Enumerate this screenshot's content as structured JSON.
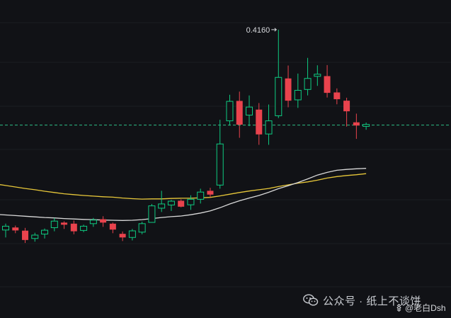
{
  "chart_data": {
    "type": "candlestick",
    "annotation": {
      "label": "0.4160",
      "value": 0.416
    },
    "current_price_line": 0.371,
    "ylim": [
      0.28,
      0.43
    ],
    "grid": "horizontal",
    "colors": {
      "up": "#0ecb81",
      "down": "#e9434d",
      "ma_fast": "#d9d9d9",
      "ma_slow": "#e7c739",
      "price_line": "#2ebd85",
      "background": "#111216",
      "grid": "#1c1e23"
    },
    "candles": [
      {
        "o": 0.3215,
        "h": 0.3245,
        "l": 0.318,
        "c": 0.3233
      },
      {
        "o": 0.3227,
        "h": 0.3236,
        "l": 0.32,
        "c": 0.3213
      },
      {
        "o": 0.3212,
        "h": 0.3225,
        "l": 0.3154,
        "c": 0.3168
      },
      {
        "o": 0.3175,
        "h": 0.3202,
        "l": 0.316,
        "c": 0.3191
      },
      {
        "o": 0.3196,
        "h": 0.3222,
        "l": 0.3175,
        "c": 0.3214
      },
      {
        "o": 0.3226,
        "h": 0.3272,
        "l": 0.3209,
        "c": 0.3257
      },
      {
        "o": 0.325,
        "h": 0.3256,
        "l": 0.322,
        "c": 0.324
      },
      {
        "o": 0.3245,
        "h": 0.326,
        "l": 0.3195,
        "c": 0.3209
      },
      {
        "o": 0.3213,
        "h": 0.324,
        "l": 0.3205,
        "c": 0.3233
      },
      {
        "o": 0.3245,
        "h": 0.3272,
        "l": 0.323,
        "c": 0.3262
      },
      {
        "o": 0.3266,
        "h": 0.328,
        "l": 0.323,
        "c": 0.325
      },
      {
        "o": 0.3245,
        "h": 0.325,
        "l": 0.32,
        "c": 0.3217
      },
      {
        "o": 0.3197,
        "h": 0.3208,
        "l": 0.3163,
        "c": 0.318
      },
      {
        "o": 0.318,
        "h": 0.322,
        "l": 0.3166,
        "c": 0.3211
      },
      {
        "o": 0.3205,
        "h": 0.3254,
        "l": 0.3195,
        "c": 0.3245
      },
      {
        "o": 0.3251,
        "h": 0.3338,
        "l": 0.325,
        "c": 0.3329
      },
      {
        "o": 0.3318,
        "h": 0.34,
        "l": 0.33,
        "c": 0.3338
      },
      {
        "o": 0.3333,
        "h": 0.3357,
        "l": 0.3305,
        "c": 0.3351
      },
      {
        "o": 0.3353,
        "h": 0.336,
        "l": 0.3322,
        "c": 0.3325
      },
      {
        "o": 0.3334,
        "h": 0.3379,
        "l": 0.331,
        "c": 0.336
      },
      {
        "o": 0.336,
        "h": 0.341,
        "l": 0.334,
        "c": 0.3394
      },
      {
        "o": 0.34,
        "h": 0.3414,
        "l": 0.337,
        "c": 0.3382
      },
      {
        "o": 0.3427,
        "h": 0.3735,
        "l": 0.341,
        "c": 0.3621
      },
      {
        "o": 0.373,
        "h": 0.3853,
        "l": 0.3708,
        "c": 0.3822
      },
      {
        "o": 0.3824,
        "h": 0.3868,
        "l": 0.365,
        "c": 0.3712
      },
      {
        "o": 0.3757,
        "h": 0.385,
        "l": 0.3705,
        "c": 0.3795
      },
      {
        "o": 0.3783,
        "h": 0.3814,
        "l": 0.3617,
        "c": 0.3666
      },
      {
        "o": 0.3668,
        "h": 0.3807,
        "l": 0.3617,
        "c": 0.373
      },
      {
        "o": 0.3754,
        "h": 0.416,
        "l": 0.3743,
        "c": 0.3935
      },
      {
        "o": 0.393,
        "h": 0.3991,
        "l": 0.3794,
        "c": 0.3825
      },
      {
        "o": 0.3829,
        "h": 0.3953,
        "l": 0.3791,
        "c": 0.3874
      },
      {
        "o": 0.3878,
        "h": 0.4027,
        "l": 0.385,
        "c": 0.393
      },
      {
        "o": 0.394,
        "h": 0.3992,
        "l": 0.3895,
        "c": 0.395
      },
      {
        "o": 0.3941,
        "h": 0.3993,
        "l": 0.384,
        "c": 0.3862
      },
      {
        "o": 0.3864,
        "h": 0.3883,
        "l": 0.3808,
        "c": 0.3832
      },
      {
        "o": 0.3825,
        "h": 0.3839,
        "l": 0.3703,
        "c": 0.3775
      },
      {
        "o": 0.3723,
        "h": 0.3764,
        "l": 0.3645,
        "c": 0.3708
      },
      {
        "o": 0.3704,
        "h": 0.3722,
        "l": 0.3688,
        "c": 0.3713
      }
    ],
    "ma_fast": [
      0.3286,
      0.3283,
      0.328,
      0.3277,
      0.3274,
      0.3272,
      0.3269,
      0.3267,
      0.3265,
      0.3264,
      0.3262,
      0.3261,
      0.326,
      0.3261,
      0.3264,
      0.3269,
      0.3274,
      0.3278,
      0.3281,
      0.3287,
      0.3295,
      0.3305,
      0.332,
      0.3338,
      0.3353,
      0.3366,
      0.3378,
      0.3393,
      0.341,
      0.3424,
      0.3439,
      0.3456,
      0.3474,
      0.3487,
      0.3497,
      0.3501,
      0.3504,
      0.3506
    ],
    "ma_slow": [
      0.3425,
      0.3418,
      0.3411,
      0.3405,
      0.3398,
      0.3392,
      0.3386,
      0.3382,
      0.3378,
      0.3375,
      0.3372,
      0.337,
      0.3366,
      0.3363,
      0.3361,
      0.3362,
      0.3362,
      0.3364,
      0.3365,
      0.3365,
      0.3367,
      0.3369,
      0.3376,
      0.3384,
      0.3392,
      0.3399,
      0.3405,
      0.3411,
      0.342,
      0.3428,
      0.3436,
      0.3442,
      0.345,
      0.346,
      0.3467,
      0.3472,
      0.3476,
      0.3481
    ]
  },
  "watermark": {
    "text": "公众号 · 纸上不谈饼",
    "handle": "@老白Dsh"
  }
}
